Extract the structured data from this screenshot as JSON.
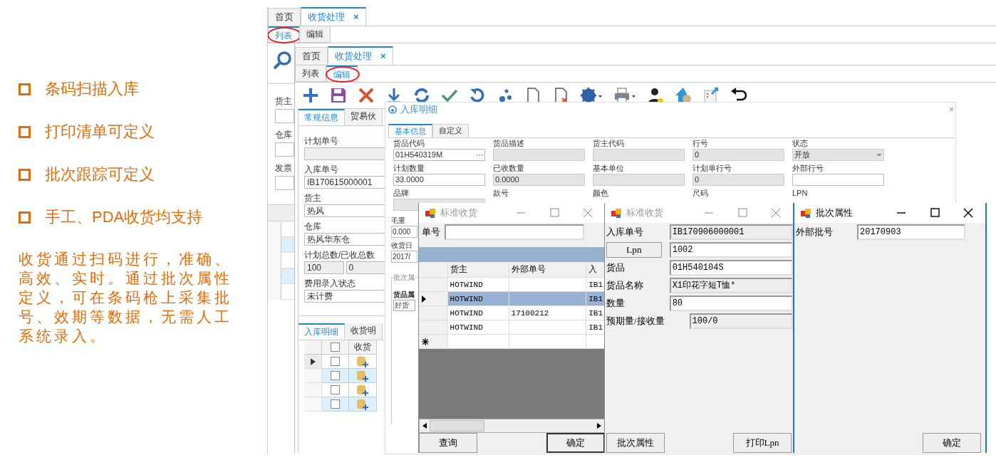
{
  "slide": {
    "bullets": [
      "条码扫描入库",
      "打印清单可定义",
      "批次跟踪可定义",
      "手工、PDA收货均支持"
    ],
    "paragraph": "收货通过扫码进行，准确、高效、实时。通过批次属性定义，可在条码枪上采集批号、效期等数据，无需人工系统录入。"
  },
  "list_window": {
    "tabs": [
      {
        "label": "首页",
        "selected": false
      },
      {
        "label": "收货处理",
        "selected": true,
        "close": "×"
      }
    ],
    "subtabs": [
      {
        "label": "列表",
        "selected": true,
        "circled": true
      },
      {
        "label": "编辑",
        "selected": false,
        "circled": false
      }
    ],
    "labels": [
      "货主",
      "仓库",
      "发票"
    ]
  },
  "edit_window": {
    "tabs": [
      {
        "label": "首页",
        "selected": false
      },
      {
        "label": "收货处理",
        "selected": true,
        "close": "×"
      }
    ],
    "subtabs": [
      {
        "label": "列表",
        "selected": false,
        "circled": false
      },
      {
        "label": "编辑",
        "selected": true,
        "circled": true
      }
    ],
    "form_tabs": [
      {
        "label": "常规信息",
        "selected": true
      },
      {
        "label": "贸易伙",
        "selected": false
      }
    ],
    "fields": [
      {
        "kind": "text",
        "label": "计划单号",
        "disabled": true
      },
      {
        "kind": "text",
        "label": "入库单号",
        "value": "IB170615000001",
        "disabled": false
      },
      {
        "kind": "text",
        "label": "货主",
        "value": "热风",
        "disabled": false
      },
      {
        "kind": "text",
        "label": "仓库",
        "value": "热风华东仓",
        "disabled": false
      },
      {
        "kind": "pair",
        "label": "计划总数/已收总数",
        "values": [
          "100",
          "0"
        ],
        "disabled": true
      },
      {
        "kind": "text",
        "label": "费用录入状态",
        "value": "未计费",
        "disabled": false
      }
    ],
    "detail_tabs": [
      {
        "label": "入库明细",
        "selected": true
      },
      {
        "label": "收货明",
        "selected": false
      }
    ],
    "grid": {
      "header_checked": false,
      "columns": [
        "收货"
      ],
      "rows": [
        {
          "checked": false,
          "current": true
        },
        {
          "checked": false,
          "current": false
        },
        {
          "checked": false,
          "current": false
        },
        {
          "checked": false,
          "current": false
        }
      ]
    }
  },
  "detail_dialog": {
    "title": "入库明细",
    "close": "×",
    "tabs": [
      {
        "label": "基本信息",
        "selected": true
      },
      {
        "label": "自定义",
        "selected": false
      }
    ],
    "fields": [
      {
        "kind": "lookup",
        "label": "货品代码",
        "value": "01H540319M",
        "button": "···"
      },
      {
        "kind": "blurred",
        "label": "货品描述"
      },
      {
        "kind": "blurred",
        "label": "货主代码"
      },
      {
        "kind": "text",
        "label": "行号",
        "value": "0",
        "disabled": true
      },
      {
        "kind": "select",
        "label": "状态",
        "value": "开放",
        "disabled": true
      },
      {
        "kind": "text",
        "label": "计划数量",
        "value": "33.0000",
        "disabled": false
      },
      {
        "kind": "text",
        "label": "已收数量",
        "value": "0.0000",
        "disabled": true
      },
      {
        "kind": "text",
        "label": "基本单位",
        "disabled": true
      },
      {
        "kind": "text",
        "label": "计划单行号",
        "value": "0",
        "disabled": true
      },
      {
        "kind": "text",
        "label": "外部行号",
        "disabled": false
      },
      {
        "kind": "text",
        "label": "品牌",
        "disabled": true
      },
      {
        "kind": "label",
        "label": "款号"
      },
      {
        "kind": "label",
        "label": "颜色"
      },
      {
        "kind": "label",
        "label": "尺码"
      },
      {
        "kind": "label",
        "label": "LPN"
      }
    ],
    "left_fields": [
      {
        "label": "毛重",
        "value": "0.000"
      },
      {
        "label": "收货日",
        "value": "2017/"
      }
    ],
    "group": {
      "title": "批次属",
      "label": "货品属",
      "value": "好货"
    }
  },
  "receive_list": {
    "title": "标准收货",
    "active": false,
    "search_label": "单号",
    "columns": [
      "货主",
      "外部单号",
      "入"
    ],
    "rows": [
      {
        "owner": "HOTWIND",
        "column_3": "IB1",
        "selected": false
      },
      {
        "owner": "HOTWIND",
        "column_3": "IB1",
        "selected": true
      },
      {
        "owner": "HOTWIND",
        "external_no": "17100212",
        "column_3": "IB1",
        "selected": false
      },
      {
        "owner": "HOTWIND",
        "column_3": "IB1",
        "selected": false
      }
    ],
    "buttons": [
      "查询",
      "确定"
    ]
  },
  "receive_form": {
    "title": "标准收货",
    "active": false,
    "fields": [
      {
        "kind": "label",
        "label": "入库单号",
        "value": "IB170906000001",
        "readonly": true
      },
      {
        "kind": "button",
        "label": "Lpn",
        "value": "1002",
        "readonly": false
      },
      {
        "kind": "label",
        "label": "货品",
        "value": "01H540104S",
        "readonly": false
      },
      {
        "kind": "label",
        "label": "货品名称",
        "value": "X1印花字短T恤*",
        "readonly": true
      },
      {
        "kind": "label",
        "label": "数量",
        "value": "80",
        "readonly": false
      },
      {
        "kind": "wide",
        "label": "预期量/接收量",
        "value": "100/0",
        "readonly": true
      }
    ],
    "buttons": [
      "批次属性",
      "打印Lpn"
    ]
  },
  "batch_window": {
    "title": "批次属性",
    "active": true,
    "fields": [
      {
        "label": "外部批号",
        "value": "20170903"
      }
    ],
    "buttons": [
      "确定"
    ]
  }
}
